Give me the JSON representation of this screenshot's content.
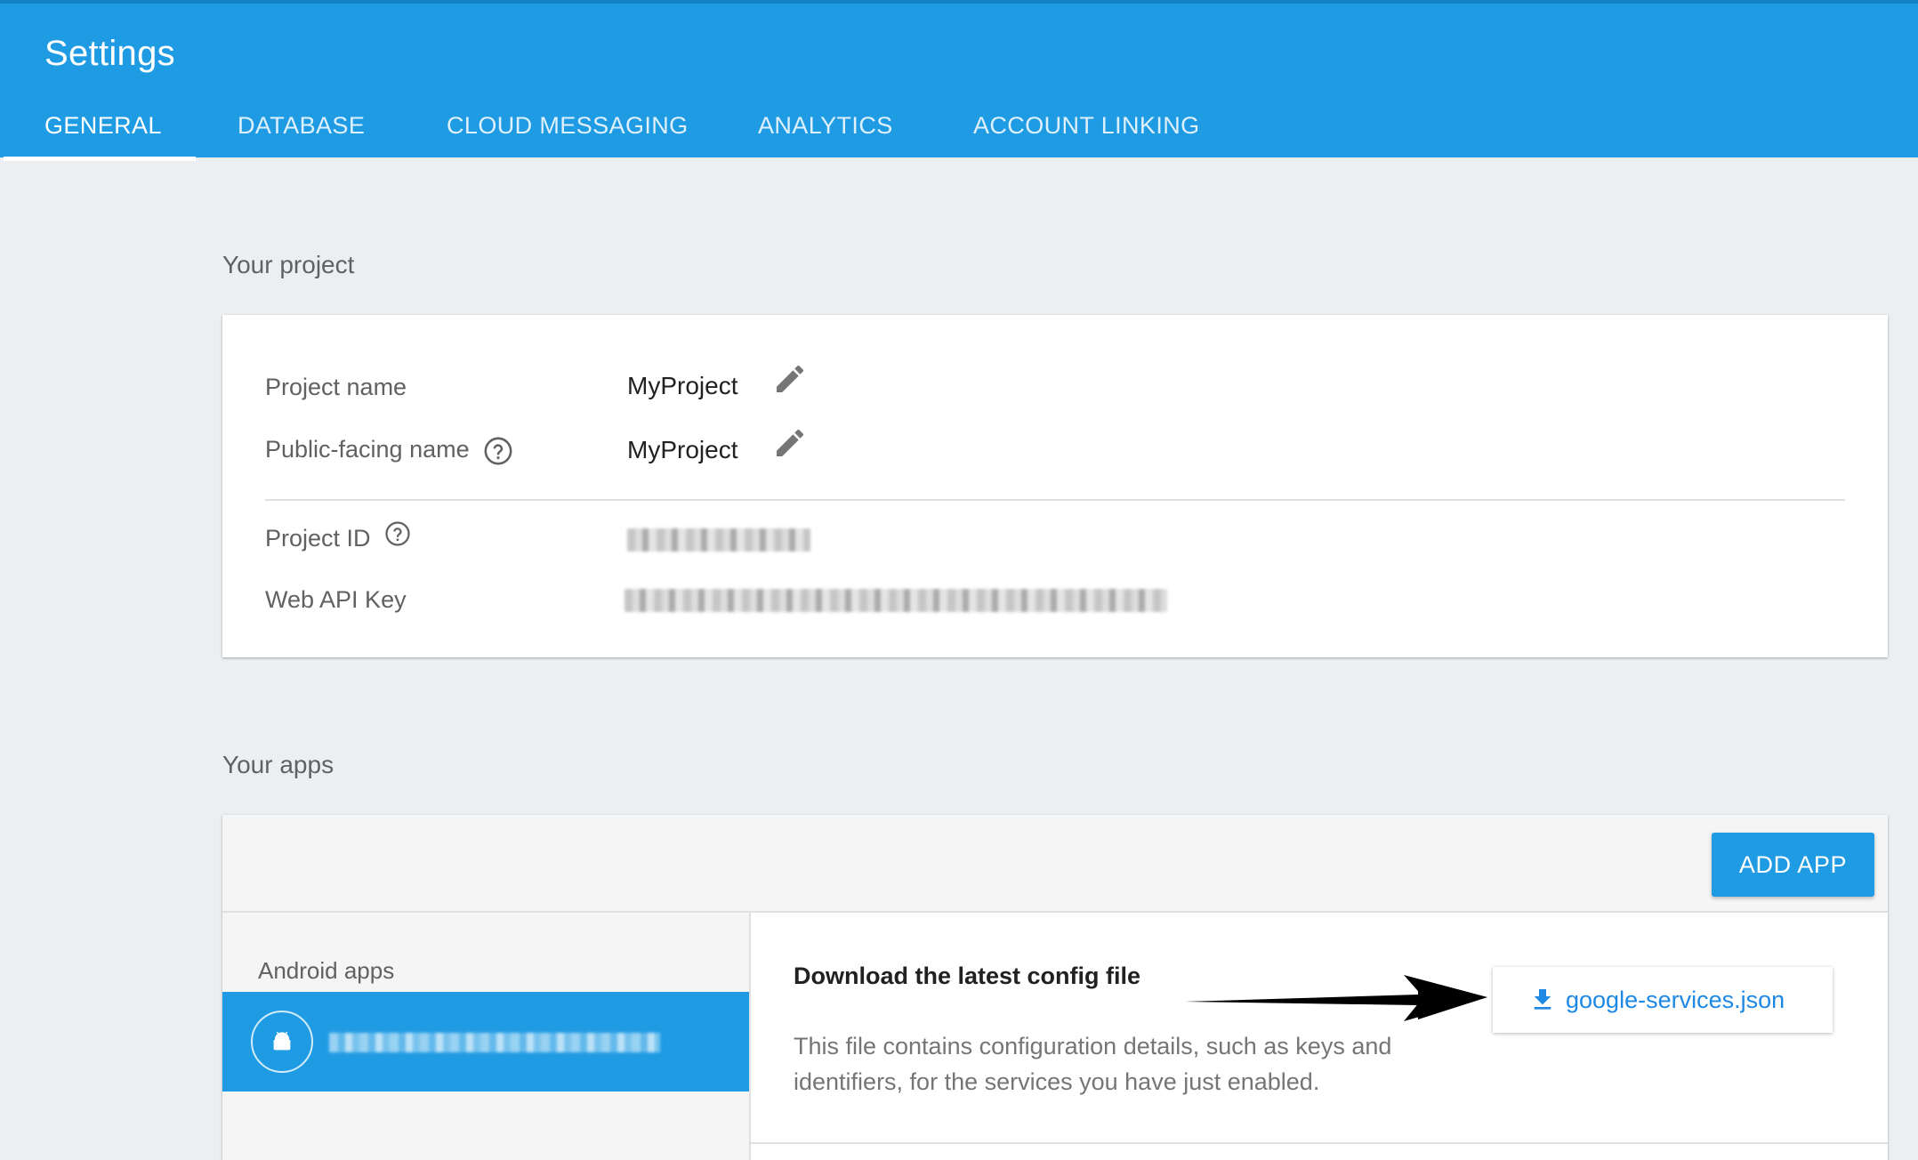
{
  "header": {
    "title": "Settings",
    "tabs": [
      {
        "label": "GENERAL",
        "active": true
      },
      {
        "label": "DATABASE",
        "active": false
      },
      {
        "label": "CLOUD MESSAGING",
        "active": false
      },
      {
        "label": "ANALYTICS",
        "active": false
      },
      {
        "label": "ACCOUNT LINKING",
        "active": false
      }
    ]
  },
  "project": {
    "section_title": "Your project",
    "rows": [
      {
        "label": "Project name",
        "value": "MyProject"
      },
      {
        "label": "Public-facing name",
        "value": "MyProject"
      },
      {
        "label": "Project ID",
        "value": ""
      },
      {
        "label": "Web API Key",
        "value": ""
      }
    ]
  },
  "apps": {
    "section_title": "Your apps",
    "add_app_label": "ADD APP",
    "group_label": "Android apps",
    "detail": {
      "heading": "Download the latest config file",
      "description": "This file contains configuration details, such as keys and identifiers, for the services you have just enabled.",
      "download_label": "google-services.json"
    }
  },
  "colors": {
    "brand": "#1e9be3",
    "link": "#1e88e5",
    "background": "#eceff1"
  },
  "icons": [
    "edit-icon",
    "help-circle-icon",
    "android-icon",
    "download-icon",
    "arrow-right-icon"
  ]
}
